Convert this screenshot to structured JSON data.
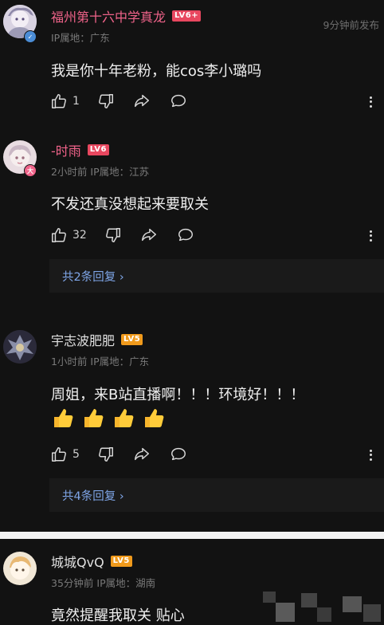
{
  "comments": [
    {
      "username": "福州第十六中学真龙",
      "level": "LV6",
      "level_suffix": "+",
      "meta": "IP属地：广东",
      "time_right": "9分钟前发布",
      "text": "我是你十年老粉，能cos李小璐吗",
      "likes": "1",
      "name_color": "#f0638a",
      "level_color": "#e8475f"
    },
    {
      "username": "-时雨",
      "level": "LV6",
      "meta": "2小时前  IP属地：江苏",
      "text": "不发还真没想起来要取关",
      "likes": "32",
      "replies": "共2条回复 ›",
      "name_color": "#f0638a",
      "level_color": "#e8475f",
      "badge_text": "大"
    },
    {
      "username": "宇志波肥肥",
      "level": "LV5",
      "meta": "1小时前  IP属地：广东",
      "text": "周姐，来B站直播啊！！！环境好！！！",
      "emoji_count": 4,
      "emoji_name": "thumbs-up",
      "likes": "5",
      "replies": "共4条回复 ›",
      "name_color": "#e0e0e0",
      "level_color": "#f09a1c"
    },
    {
      "username": "城城QvQ",
      "level": "LV5",
      "meta": "35分钟前  IP属地：湖南",
      "text": "竟然提醒我取关 贴心",
      "name_color": "#e0e0e0",
      "level_color": "#f09a1c"
    }
  ],
  "icons": {
    "like": "thumb-up-icon",
    "dislike": "thumb-down-icon",
    "share": "share-icon",
    "reply": "comment-icon",
    "more": "more-vertical-icon"
  }
}
